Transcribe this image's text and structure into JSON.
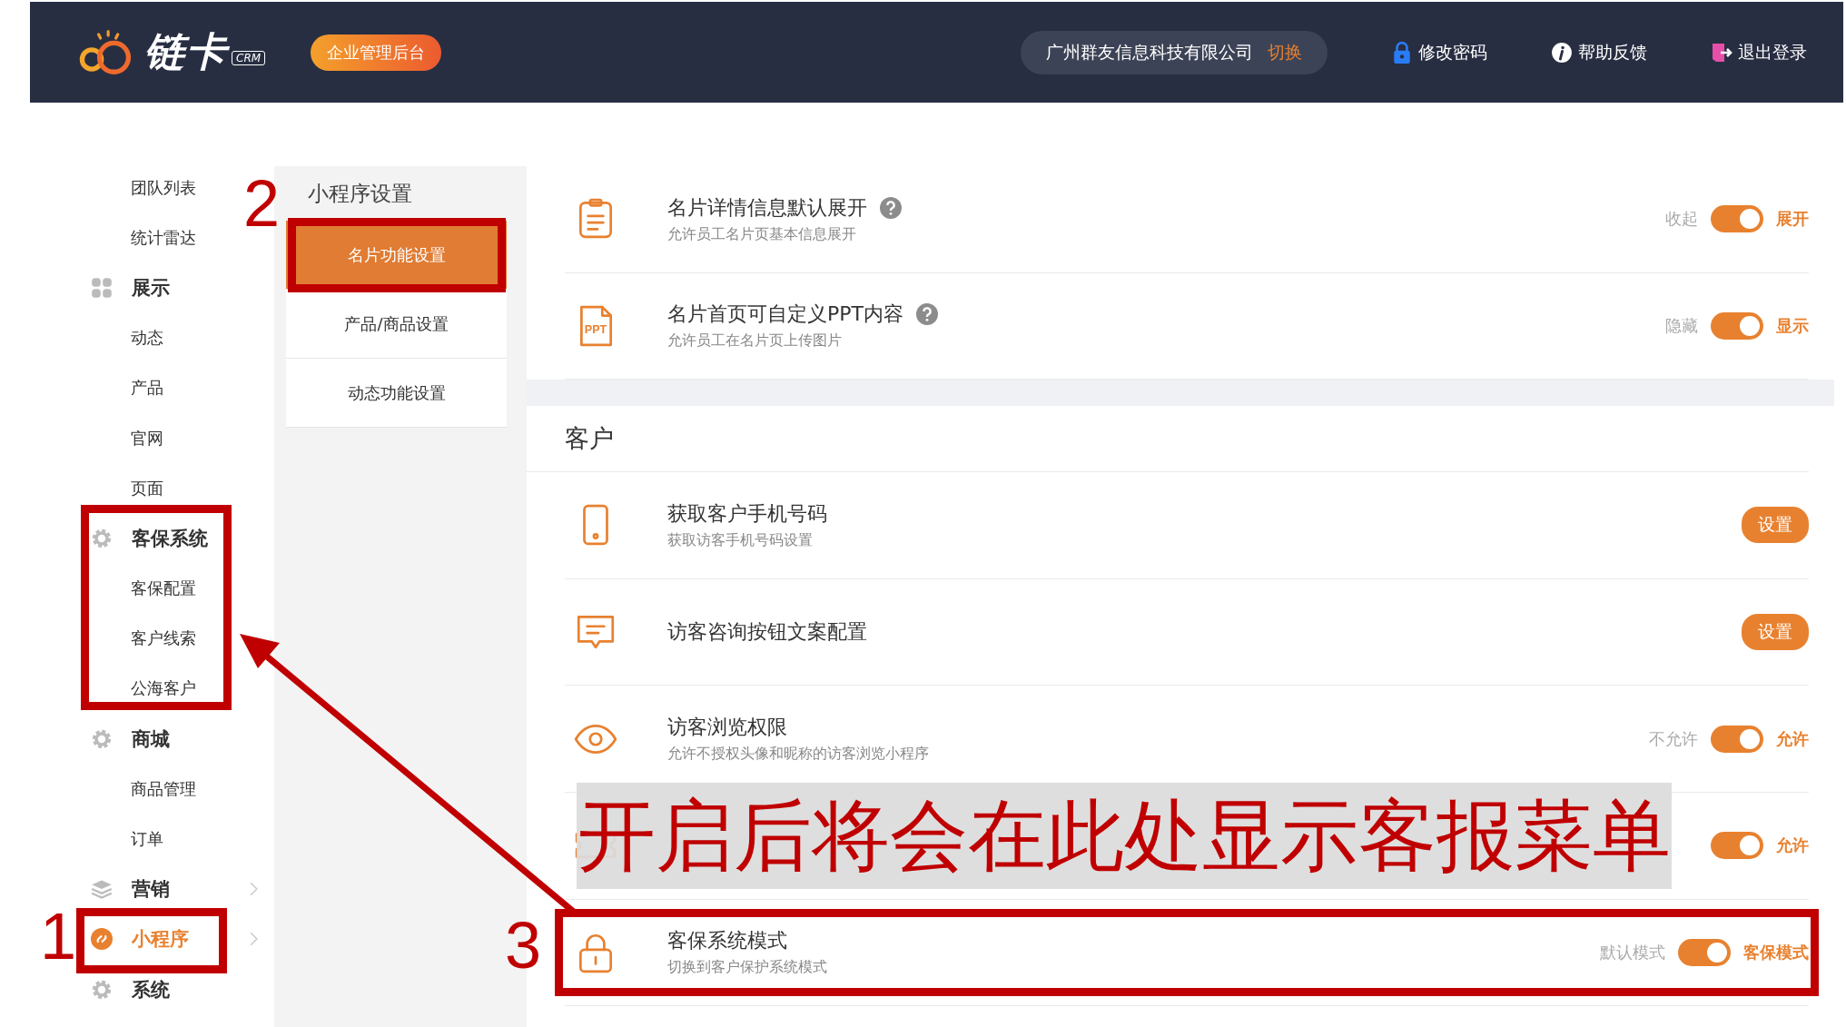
{
  "header": {
    "logo_text": "链卡",
    "logo_badge": "CRM",
    "portal_badge": "企业管理后台",
    "company": "广州群友信息科技有限公司",
    "switch_link": "切换",
    "actions": [
      {
        "label": "修改密码"
      },
      {
        "label": "帮助反馈"
      },
      {
        "label": "退出登录"
      }
    ]
  },
  "sidebar": {
    "items": [
      {
        "kind": "item",
        "label": "团队列表",
        "selected": false
      },
      {
        "kind": "item",
        "label": "统计雷达",
        "selected": false
      },
      {
        "kind": "group",
        "label": "展示",
        "selected": false,
        "expandable": false
      },
      {
        "kind": "item",
        "label": "动态",
        "selected": false
      },
      {
        "kind": "item",
        "label": "产品",
        "selected": false
      },
      {
        "kind": "item",
        "label": "官网",
        "selected": false
      },
      {
        "kind": "item",
        "label": "页面",
        "selected": false
      },
      {
        "kind": "group",
        "label": "客保系统",
        "selected": false,
        "expandable": false
      },
      {
        "kind": "item",
        "label": "客保配置",
        "selected": false
      },
      {
        "kind": "item",
        "label": "客户线索",
        "selected": false
      },
      {
        "kind": "item",
        "label": "公海客户",
        "selected": false
      },
      {
        "kind": "group",
        "label": "商城",
        "selected": false,
        "expandable": false
      },
      {
        "kind": "item",
        "label": "商品管理",
        "selected": false
      },
      {
        "kind": "item",
        "label": "订单",
        "selected": false
      },
      {
        "kind": "group",
        "label": "营销",
        "selected": false,
        "expandable": true
      },
      {
        "kind": "group",
        "label": "小程序",
        "selected": true,
        "expandable": true
      },
      {
        "kind": "group",
        "label": "系统",
        "selected": false,
        "expandable": false
      }
    ]
  },
  "submenu": {
    "title": "小程序设置",
    "items": [
      {
        "label": "名片功能设置",
        "selected": true
      },
      {
        "label": "产品/商品设置",
        "selected": false
      },
      {
        "label": "动态功能设置",
        "selected": false
      }
    ]
  },
  "main": {
    "sections": [
      {
        "rows": [
          {
            "kind": "toggle",
            "title": "名片详情信息默认展开",
            "help": true,
            "subtitle": "允许员工名片页基本信息展开",
            "off_label": "收起",
            "on_label": "展开",
            "on": true
          },
          {
            "kind": "toggle",
            "icon_label": "PPT",
            "title": "名片首页可自定义PPT内容",
            "help": true,
            "subtitle": "允许员工在名片页上传图片",
            "off_label": "隐藏",
            "on_label": "显示",
            "on": true
          }
        ]
      },
      {
        "title": "客户",
        "rows": [
          {
            "kind": "button",
            "title": "获取客户手机号码",
            "subtitle": "获取访客手机号码设置",
            "button": "设置"
          },
          {
            "kind": "button",
            "title": "访客咨询按钮文案配置",
            "button": "设置"
          },
          {
            "kind": "toggle",
            "title": "访客浏览权限",
            "subtitle": "允许不授权头像和昵称的访客浏览小程序",
            "off_label": "不允许",
            "on_label": "允许",
            "on": true
          },
          {
            "kind": "toggle",
            "on_label": "允许",
            "on": true
          },
          {
            "kind": "toggle",
            "title": "客保系统模式",
            "subtitle": "切换到客户保护系统模式",
            "off_label": "默认模式",
            "on_label": "客保模式",
            "on": true
          }
        ]
      }
    ]
  },
  "annotations": {
    "step_numbers": [
      "1",
      "2",
      "3"
    ],
    "caption": "开启后将会在此处显示客报菜单"
  }
}
